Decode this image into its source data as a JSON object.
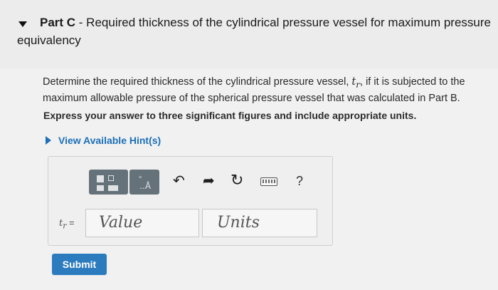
{
  "part": {
    "label": "Part C",
    "title_rest": " - Required thickness of the cylindrical pressure vessel for maximum pressure",
    "title_line2": "equivalency"
  },
  "question": {
    "text_before": "Determine the required thickness of the cylindrical pressure vessel, ",
    "var_symbol": "t",
    "var_sub": "r",
    "text_after": ", if it is subjected to the maximum allowable pressure of the spherical pressure vessel that was calculated in Part B.",
    "instruction": "Express your answer to three significant figures and include appropriate units."
  },
  "hint": {
    "label": "View Available Hint(s)"
  },
  "answer": {
    "var_label_symbol": "t",
    "var_label_sub": "r",
    "var_label_eq": " =",
    "value_placeholder": "Value",
    "units_placeholder": "Units",
    "help_label": "?"
  },
  "submit": {
    "label": "Submit"
  },
  "colors": {
    "accent": "#1a6fb8",
    "button": "#2c7bbf",
    "toolbar": "#66727a"
  },
  "icons": [
    "caret-down-icon",
    "caret-right-icon",
    "templates-icon",
    "symbols-icon",
    "undo-icon",
    "redo-icon",
    "reset-icon",
    "keyboard-icon",
    "help-icon"
  ]
}
